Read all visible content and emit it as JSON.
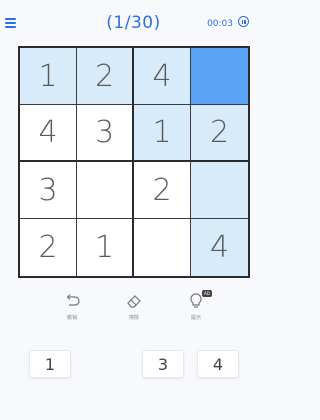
{
  "header": {
    "title": "(1/30)",
    "timer": "00:03",
    "menu_icon": "menu-icon",
    "pause_icon": "pause-icon",
    "accent_color": "#2e6fe6"
  },
  "board": {
    "size": 4,
    "rows": [
      [
        "1",
        "2",
        "4",
        ""
      ],
      [
        "4",
        "3",
        "1",
        "2"
      ],
      [
        "3",
        "",
        "2",
        ""
      ],
      [
        "2",
        "1",
        "",
        "4"
      ]
    ],
    "selected_cell": [
      0,
      3
    ],
    "highlight_color": "#d7ebfa",
    "selected_color": "#5aa2f3"
  },
  "tools": {
    "undo_label": "撤销",
    "erase_label": "擦除",
    "hint_label": "提示",
    "hint_badge": "AD"
  },
  "numpad": {
    "keys": [
      "1",
      "3",
      "4"
    ]
  }
}
